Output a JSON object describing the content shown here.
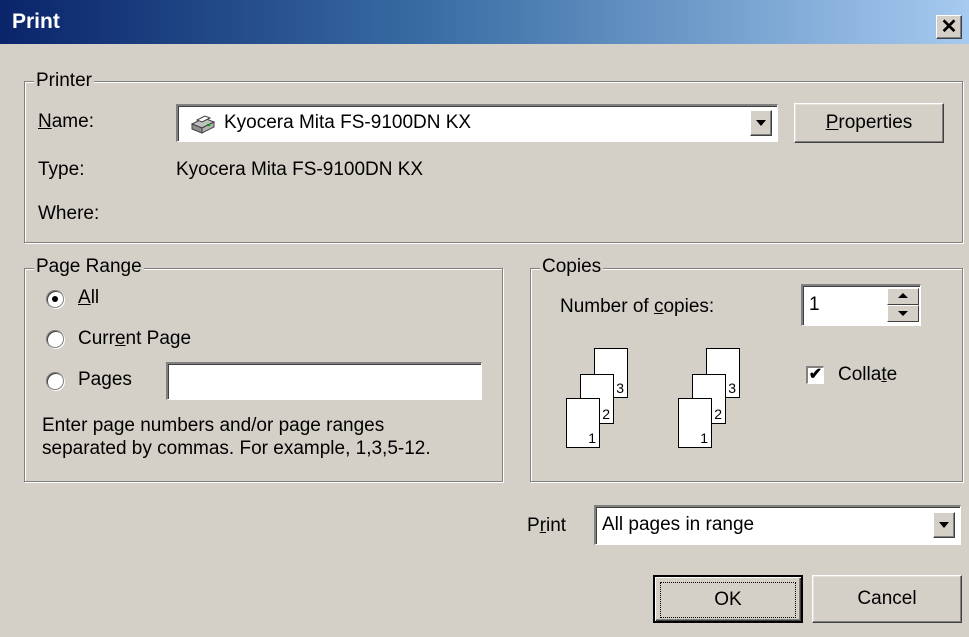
{
  "window": {
    "title": "Print",
    "close_glyph": "✕"
  },
  "printer": {
    "legend": "Printer",
    "name_label": "Name:",
    "name_value": "Kyocera Mita FS-9100DN KX",
    "properties_label": "Properties",
    "type_label": "Type:",
    "type_value": "Kyocera Mita FS-9100DN KX",
    "where_label": "Where:"
  },
  "page_range": {
    "legend": "Page Range",
    "options": [
      {
        "label": "All",
        "checked": true
      },
      {
        "label": "Current Page",
        "checked": false
      },
      {
        "label": "Pages",
        "checked": false
      }
    ],
    "pages_value": "",
    "help_line1": "Enter page numbers and/or page ranges",
    "help_line2": "separated by commas.  For example, 1,3,5-12."
  },
  "copies": {
    "legend": "Copies",
    "number_label": "Number of copies:",
    "number_value": "1",
    "collate_label": "Collate",
    "collate_checked": true,
    "stack_numbers": [
      "3",
      "2",
      "1"
    ]
  },
  "print_what": {
    "label": "Print",
    "value": "All pages in range"
  },
  "buttons": {
    "ok": "OK",
    "cancel": "Cancel"
  },
  "colors": {
    "title_start": "#0a246a",
    "title_end": "#a6caf0",
    "face": "#d4d0c8"
  },
  "icons": {
    "printer": "printer-icon",
    "dropdown": "chevron-down-icon",
    "checkmark": "checkmark-icon"
  }
}
